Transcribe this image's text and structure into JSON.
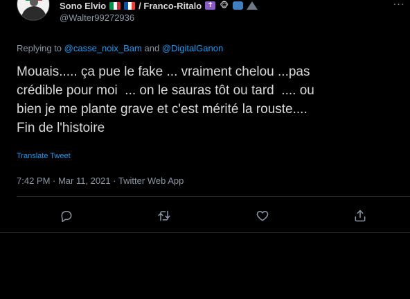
{
  "author": {
    "display_name": "Sono Elvio",
    "name_suffix": "/ Franco-Ritalo",
    "handle": "@Walter99272936"
  },
  "reply": {
    "prefix": "Replying to",
    "mention1": "@casse_noix_Bam",
    "and": "and",
    "mention2": "@DigitalGanon"
  },
  "tweet": {
    "text": "Mouais..... ça pue le fake ... vraiment chelou ...pas\ncrédible pour moi  ... on le sauras tôt ou tard  .... ou\nbien je me plante grave et c'est mérité la rouste....\nFin de l'histoire",
    "translate_label": "Translate Tweet",
    "meta": "7:42 PM · Mar 11, 2021 · Twitter Web App"
  },
  "icons": {
    "cross": "✝",
    "face": "🐵",
    "more": "···"
  },
  "colors": {
    "background": "#000000",
    "text": "#d9d9d9",
    "muted": "#8b98a5",
    "link": "#1d9bf0",
    "divider": "#2f3336"
  }
}
